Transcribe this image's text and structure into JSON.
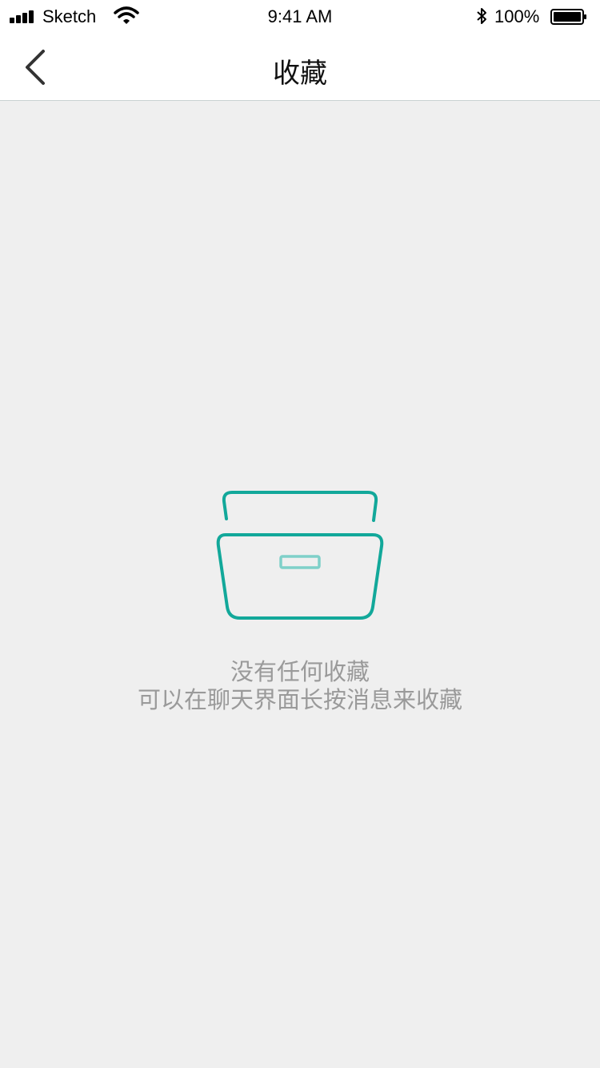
{
  "status_bar": {
    "carrier": "Sketch",
    "time": "9:41 AM",
    "battery_percent": "100%",
    "icons": [
      "signal-icon",
      "wifi-icon",
      "bluetooth-icon",
      "battery-icon"
    ]
  },
  "nav": {
    "title": "收藏",
    "back_icon": "chevron-left-icon"
  },
  "empty_state": {
    "icon": "archive-box-icon",
    "title": "没有任何收藏",
    "hint": "可以在聊天界面长按消息来收藏"
  },
  "colors": {
    "accent": "#12a89a",
    "accent_light": "#7fd0c9",
    "background": "#efefef",
    "text_muted": "#9a9a9a"
  }
}
